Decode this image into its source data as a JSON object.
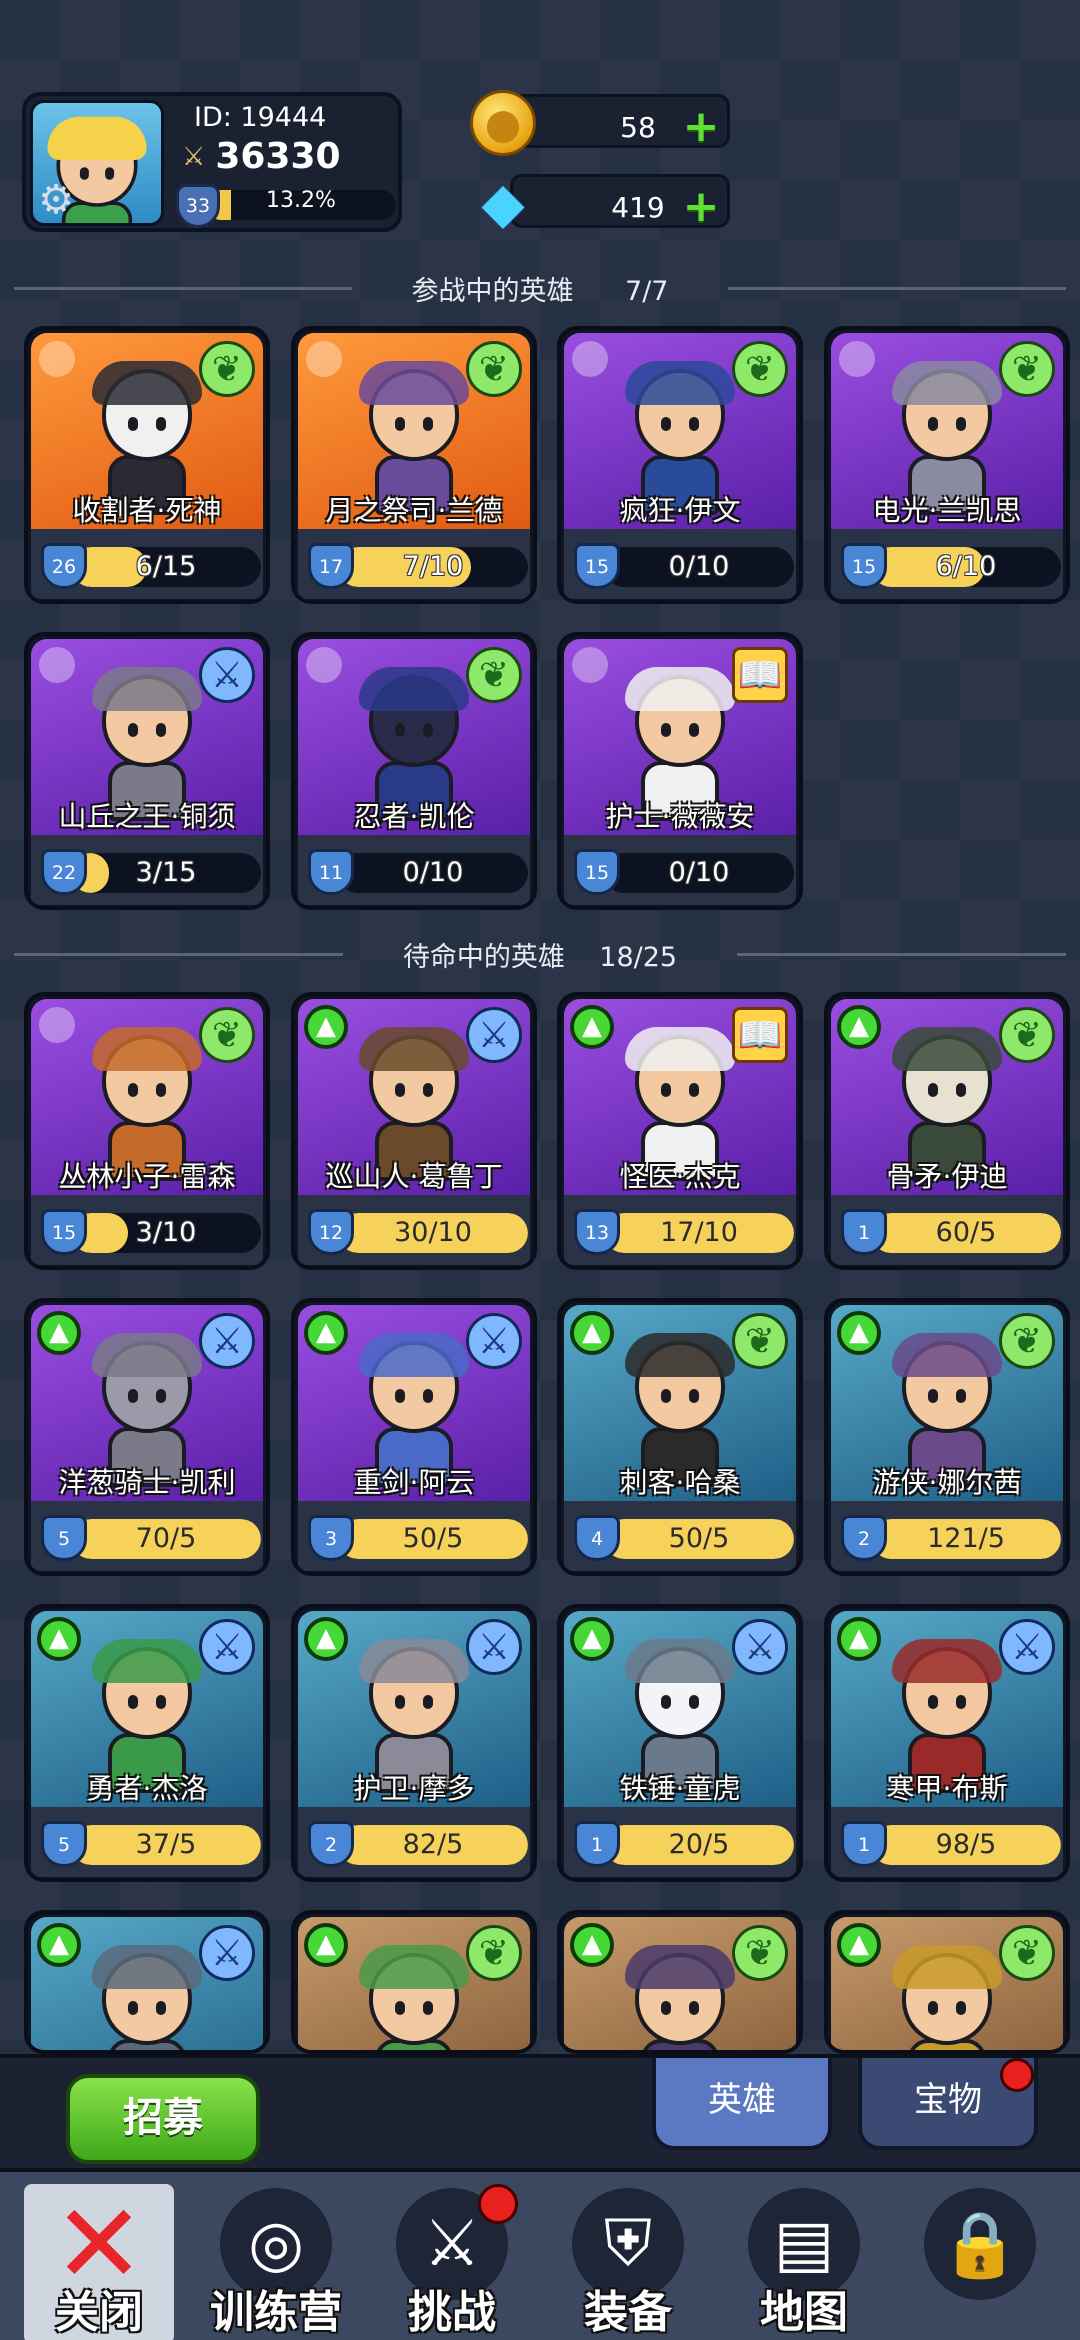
{
  "player": {
    "id_text": "ID: 19444",
    "power": "36330",
    "level": "33",
    "exp_text": "13.2%",
    "exp_fraction": 0.132
  },
  "currency": {
    "gold": "58",
    "gems": "419"
  },
  "sections": {
    "active_title": "参战中的英雄      7/7",
    "standby_title": "待命中的英雄    18/25"
  },
  "active_heroes": [
    {
      "name": "收割者·死神",
      "level": "26",
      "progress": "6/15",
      "fill": 0.4,
      "theme": "orange",
      "badge": "wing",
      "upgrade": false,
      "skin": "#f0f0f0",
      "outfit": "#2a2a34"
    },
    {
      "name": "月之祭司·兰德",
      "level": "17",
      "progress": "7/10",
      "fill": 0.7,
      "theme": "orange",
      "badge": "wing",
      "upgrade": false,
      "skin": "#f2c9a0",
      "outfit": "#6a4a9a"
    },
    {
      "name": "疯狂·伊文",
      "level": "15",
      "progress": "0/10",
      "fill": 0,
      "theme": "purple",
      "badge": "wing",
      "upgrade": false,
      "skin": "#f2c9a0",
      "outfit": "#2a4a9a"
    },
    {
      "name": "电光·兰凯思",
      "level": "15",
      "progress": "6/10",
      "fill": 0.6,
      "theme": "purple",
      "badge": "wing",
      "upgrade": false,
      "skin": "#f2c9a0",
      "outfit": "#8a8aa0"
    },
    {
      "name": "山丘之王·铜须",
      "level": "22",
      "progress": "3/15",
      "fill": 0.2,
      "theme": "purple",
      "badge": "sword",
      "upgrade": false,
      "skin": "#f2c9a0",
      "outfit": "#7a7a88"
    },
    {
      "name": "忍者·凯伦",
      "level": "11",
      "progress": "0/10",
      "fill": 0,
      "theme": "purple",
      "badge": "wing",
      "upgrade": false,
      "skin": "#2a2a4a",
      "outfit": "#2a3a8a"
    },
    {
      "name": "护士·薇薇安",
      "level": "15",
      "progress": "0/10",
      "fill": 0,
      "theme": "purple",
      "badge": "book",
      "upgrade": false,
      "skin": "#f2c9a0",
      "outfit": "#f0f0f0"
    }
  ],
  "standby_heroes": [
    {
      "name": "丛林小子·雷森",
      "level": "15",
      "progress": "3/10",
      "fill": 0.3,
      "theme": "purple",
      "badge": "wing",
      "upgrade": false,
      "skin": "#f2c9a0",
      "outfit": "#c46a2a"
    },
    {
      "name": "巡山人·葛鲁丁",
      "level": "12",
      "progress": "30/10",
      "fill": 1,
      "theme": "purple",
      "badge": "sword",
      "upgrade": true,
      "skin": "#f2c9a0",
      "outfit": "#6a4a2a"
    },
    {
      "name": "怪医·杰克",
      "level": "13",
      "progress": "17/10",
      "fill": 1,
      "theme": "purple",
      "badge": "book",
      "upgrade": true,
      "skin": "#f2c9a0",
      "outfit": "#f0f0f0"
    },
    {
      "name": "骨矛·伊迪",
      "level": "1",
      "progress": "60/5",
      "fill": 1,
      "theme": "purple",
      "badge": "wing",
      "upgrade": true,
      "skin": "#e8e0d0",
      "outfit": "#3a4a3a"
    },
    {
      "name": "洋葱骑士·凯利",
      "level": "5",
      "progress": "70/5",
      "fill": 1,
      "theme": "purple",
      "badge": "sword",
      "upgrade": true,
      "skin": "#9a9aa8",
      "outfit": "#7a7a88"
    },
    {
      "name": "重剑·阿云",
      "level": "3",
      "progress": "50/5",
      "fill": 1,
      "theme": "purple",
      "badge": "sword",
      "upgrade": true,
      "skin": "#f2c9a0",
      "outfit": "#4a6ac8"
    },
    {
      "name": "刺客·哈桑",
      "level": "4",
      "progress": "50/5",
      "fill": 1,
      "theme": "teal",
      "badge": "wing",
      "upgrade": true,
      "skin": "#f2c9a0",
      "outfit": "#2a2a2a"
    },
    {
      "name": "游侠·娜尔茜",
      "level": "2",
      "progress": "121/5",
      "fill": 1,
      "theme": "teal",
      "badge": "wing",
      "upgrade": true,
      "skin": "#f2c9a0",
      "outfit": "#6a4a8a"
    },
    {
      "name": "勇者·杰洛",
      "level": "5",
      "progress": "37/5",
      "fill": 1,
      "theme": "teal",
      "badge": "sword",
      "upgrade": true,
      "skin": "#f2c9a0",
      "outfit": "#3a9a4a"
    },
    {
      "name": "护卫·摩多",
      "level": "2",
      "progress": "82/5",
      "fill": 1,
      "theme": "teal",
      "badge": "sword",
      "upgrade": true,
      "skin": "#f2c9a0",
      "outfit": "#8a8a98"
    },
    {
      "name": "铁锤·童虎",
      "level": "1",
      "progress": "20/5",
      "fill": 1,
      "theme": "teal",
      "badge": "sword",
      "upgrade": true,
      "skin": "#f4f4f8",
      "outfit": "#6a7a8a"
    },
    {
      "name": "寒甲·布斯",
      "level": "1",
      "progress": "98/5",
      "fill": 1,
      "theme": "teal",
      "badge": "sword",
      "upgrade": true,
      "skin": "#f2c9a0",
      "outfit": "#9a2a2a"
    },
    {
      "name": "",
      "level": "",
      "progress": "",
      "fill": 0,
      "theme": "teal",
      "badge": "sword",
      "upgrade": true,
      "skin": "#f2c9a0",
      "outfit": "#5a6a7a"
    },
    {
      "name": "",
      "level": "",
      "progress": "",
      "fill": 0,
      "theme": "brown",
      "badge": "wing",
      "upgrade": true,
      "skin": "#f2c9a0",
      "outfit": "#4a9a4a"
    },
    {
      "name": "",
      "level": "",
      "progress": "",
      "fill": 0,
      "theme": "brown",
      "badge": "wing",
      "upgrade": true,
      "skin": "#f2c9a0",
      "outfit": "#4a3a6a"
    },
    {
      "name": "",
      "level": "",
      "progress": "",
      "fill": 0,
      "theme": "brown",
      "badge": "wing",
      "upgrade": true,
      "skin": "#f2c9a0",
      "outfit": "#c89a2a"
    }
  ],
  "bottom": {
    "recruit_label": "招募",
    "tab_heroes": "英雄",
    "tab_treasure": "宝物"
  },
  "nav": [
    {
      "label": "关闭",
      "icon": "close-icon",
      "dot": false
    },
    {
      "label": "训练营",
      "icon": "target-icon",
      "dot": false
    },
    {
      "label": "挑战",
      "icon": "sword-shield-icon",
      "dot": true
    },
    {
      "label": "装备",
      "icon": "armor-icon",
      "dot": false
    },
    {
      "label": "地图",
      "icon": "map-icon",
      "dot": false
    },
    {
      "label": "",
      "icon": "lock-icon",
      "dot": false
    }
  ]
}
